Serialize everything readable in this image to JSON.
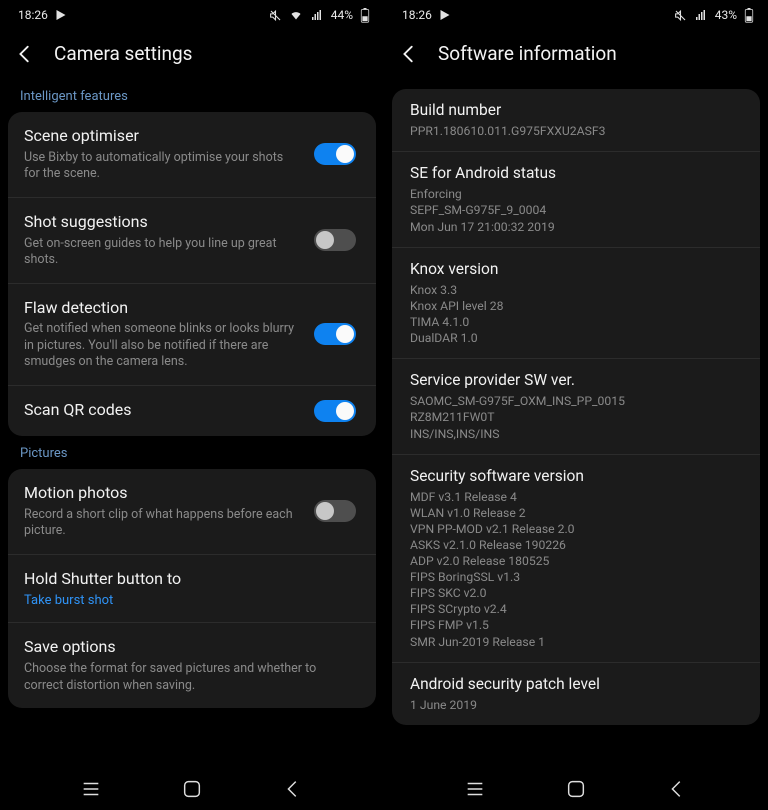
{
  "left": {
    "status": {
      "time": "18:26",
      "battery": "44%"
    },
    "title": "Camera settings",
    "sections": [
      {
        "header": "Intelligent features",
        "items": [
          {
            "title": "Scene optimiser",
            "subtitle": "Use Bixby to automatically optimise your shots for the scene.",
            "toggle": true,
            "on": true
          },
          {
            "title": "Shot suggestions",
            "subtitle": "Get on-screen guides to help you line up great shots.",
            "toggle": true,
            "on": false
          },
          {
            "title": "Flaw detection",
            "subtitle": "Get notified when someone blinks or looks blurry in pictures. You'll also be notified if there are smudges on the camera lens.",
            "toggle": true,
            "on": true
          },
          {
            "title": "Scan QR codes",
            "toggle": true,
            "on": true
          }
        ]
      },
      {
        "header": "Pictures",
        "items": [
          {
            "title": "Motion photos",
            "subtitle": "Record a short clip of what happens before each picture.",
            "toggle": true,
            "on": false
          },
          {
            "title": "Hold Shutter button to",
            "value": "Take burst shot"
          },
          {
            "title": "Save options",
            "subtitle": "Choose the format for saved pictures and whether to correct distortion when saving."
          }
        ]
      }
    ]
  },
  "right": {
    "status": {
      "time": "18:26",
      "battery": "43%"
    },
    "title": "Software information",
    "items": [
      {
        "title": "Build number",
        "lines": [
          "PPR1.180610.011.G975FXXU2ASF3"
        ]
      },
      {
        "title": "SE for Android status",
        "lines": [
          "Enforcing",
          "SEPF_SM-G975F_9_0004",
          "Mon Jun 17 21:00:32 2019"
        ]
      },
      {
        "title": "Knox version",
        "lines": [
          "Knox 3.3",
          "Knox API level 28",
          "TIMA 4.1.0",
          "DualDAR 1.0"
        ]
      },
      {
        "title": "Service provider SW ver.",
        "lines": [
          "SAOMC_SM-G975F_OXM_INS_PP_0015",
          "RZ8M211FW0T",
          "INS/INS,INS/INS"
        ]
      },
      {
        "title": "Security software version",
        "lines": [
          "MDF v3.1 Release 4",
          "WLAN v1.0 Release 2",
          "VPN PP-MOD v2.1 Release 2.0",
          "ASKS v2.1.0 Release 190226",
          "ADP v2.0 Release 180525",
          "FIPS BoringSSL v1.3",
          "FIPS SKC v2.0",
          "FIPS SCrypto v2.4",
          "FIPS FMP v1.5",
          "SMR Jun-2019 Release 1"
        ]
      },
      {
        "title": "Android security patch level",
        "lines": [
          "1 June 2019"
        ]
      }
    ]
  }
}
